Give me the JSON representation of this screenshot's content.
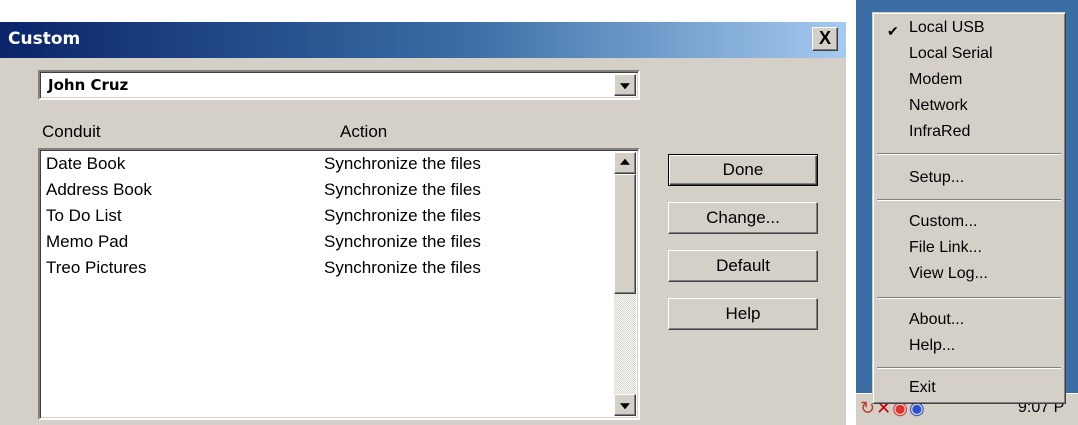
{
  "dialog": {
    "title": "Custom",
    "close_label": "X",
    "user": "John Cruz",
    "headers": {
      "conduit": "Conduit",
      "action": "Action"
    },
    "rows": [
      {
        "conduit": "Date Book",
        "action": "Synchronize the files"
      },
      {
        "conduit": "Address Book",
        "action": "Synchronize the files"
      },
      {
        "conduit": "To Do List",
        "action": "Synchronize the files"
      },
      {
        "conduit": "Memo Pad",
        "action": "Synchronize the files"
      },
      {
        "conduit": "Treo Pictures",
        "action": "Synchronize the files"
      }
    ],
    "buttons": {
      "done": "Done",
      "change": "Change...",
      "default": "Default",
      "help": "Help"
    }
  },
  "menu": {
    "items": [
      {
        "label": "Local USB",
        "checked": true
      },
      {
        "label": "Local Serial"
      },
      {
        "label": "Modem"
      },
      {
        "label": "Network"
      },
      {
        "label": "InfraRed"
      },
      {
        "label": "Setup..."
      },
      {
        "label": "Custom..."
      },
      {
        "label": "File Link..."
      },
      {
        "label": "View Log..."
      },
      {
        "label": "About..."
      },
      {
        "label": "Help..."
      },
      {
        "label": "Exit"
      }
    ]
  },
  "taskbar": {
    "clock": "9:07 P"
  },
  "icons": {
    "check": "check-icon",
    "close": "close-icon",
    "dropdown": "chevron-down-icon",
    "scroll_up": "scroll-up-icon",
    "scroll_down": "scroll-down-icon",
    "tray": [
      "hotsync-icon",
      "disconnected-icon",
      "tray-app-icon",
      "network-icon"
    ]
  },
  "colors": {
    "title_start": "#0a246a",
    "title_end": "#a6caf0",
    "face": "#d4d0c8",
    "desktop": "#3a6ea5"
  }
}
